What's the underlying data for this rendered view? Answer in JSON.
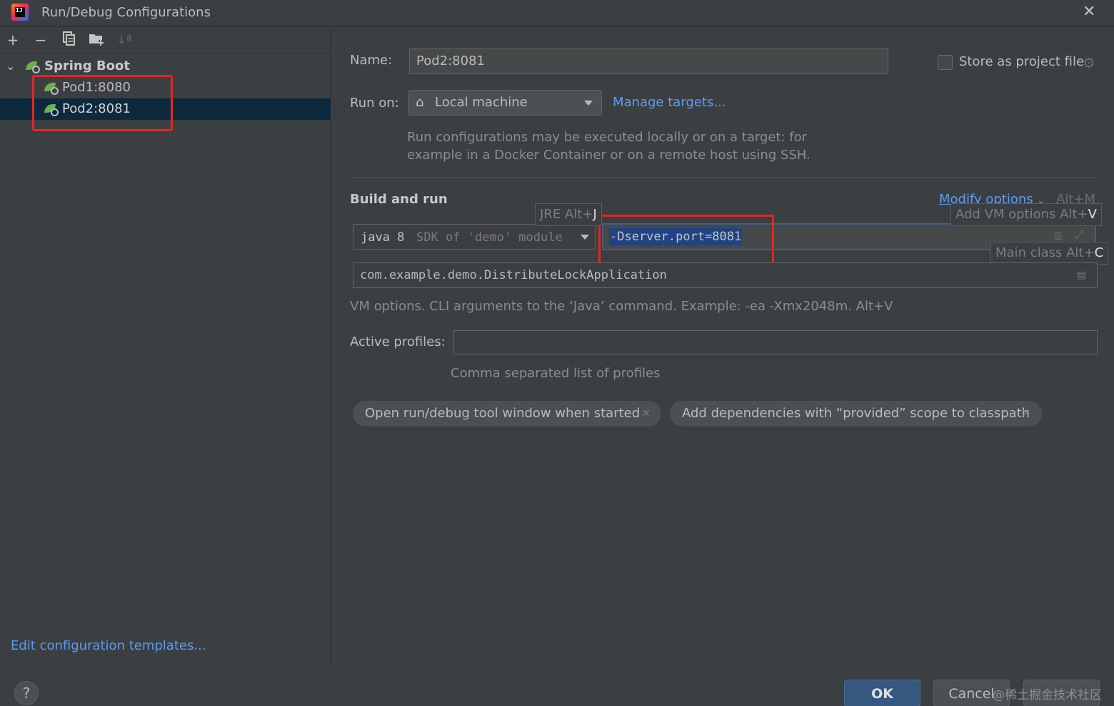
{
  "window": {
    "title": "Run/Debug Configurations",
    "logo_text": "IJ"
  },
  "toolbar": {
    "icons": [
      "add-icon",
      "remove-icon",
      "copy-icon",
      "folder-icon",
      "sort-icon"
    ]
  },
  "tree": {
    "group": "Spring Boot",
    "items": [
      "Pod1:8080",
      "Pod2:8081"
    ],
    "selected": "Pod2:8081"
  },
  "edit_templates": "Edit configuration templates...",
  "form": {
    "name_label": "Name:",
    "name_value": "Pod2:8081",
    "store_label": "Store as project file",
    "run_on_label": "Run on:",
    "run_on_value": "Local machine",
    "manage_targets": "Manage targets...",
    "run_on_hint_1": "Run configurations may be executed locally or on a target: for",
    "run_on_hint_2": "example in a Docker Container or on a remote host using SSH.",
    "build_and_run": "Build and run",
    "modify_options": "Modify options",
    "modify_shortcut": "Alt+M",
    "jre_tooltip": "JRE Alt+",
    "jre_tooltip_key": "J",
    "add_vm_tooltip": "Add VM options Alt+",
    "add_vm_tooltip_key": "V",
    "main_class_tooltip": "Main class Alt+",
    "main_class_tooltip_key": "C",
    "sdk_main": "java 8",
    "sdk_detail": "SDK of 'demo' module",
    "vm_options": "-Dserver.port=8081",
    "main_class": "com.example.demo.DistributeLockApplication",
    "vm_hint": "VM options. CLI arguments to the ‘Java’ command. Example: -ea -Xmx2048m. Alt+V",
    "profiles_label": "Active profiles:",
    "profiles_value": "",
    "profiles_hint": "Comma separated list of profiles",
    "chips": [
      "Open run/debug tool window when started",
      "Add dependencies with “provided” scope to classpath"
    ]
  },
  "footer": {
    "help": "?",
    "ok": "OK",
    "cancel": "Cancel",
    "watermark": "@稀土掘金技术社区"
  },
  "colors": {
    "accent": "#589df6",
    "selection": "#0d293e",
    "highlight_box": "#e5261f",
    "ok_button": "#365880"
  }
}
